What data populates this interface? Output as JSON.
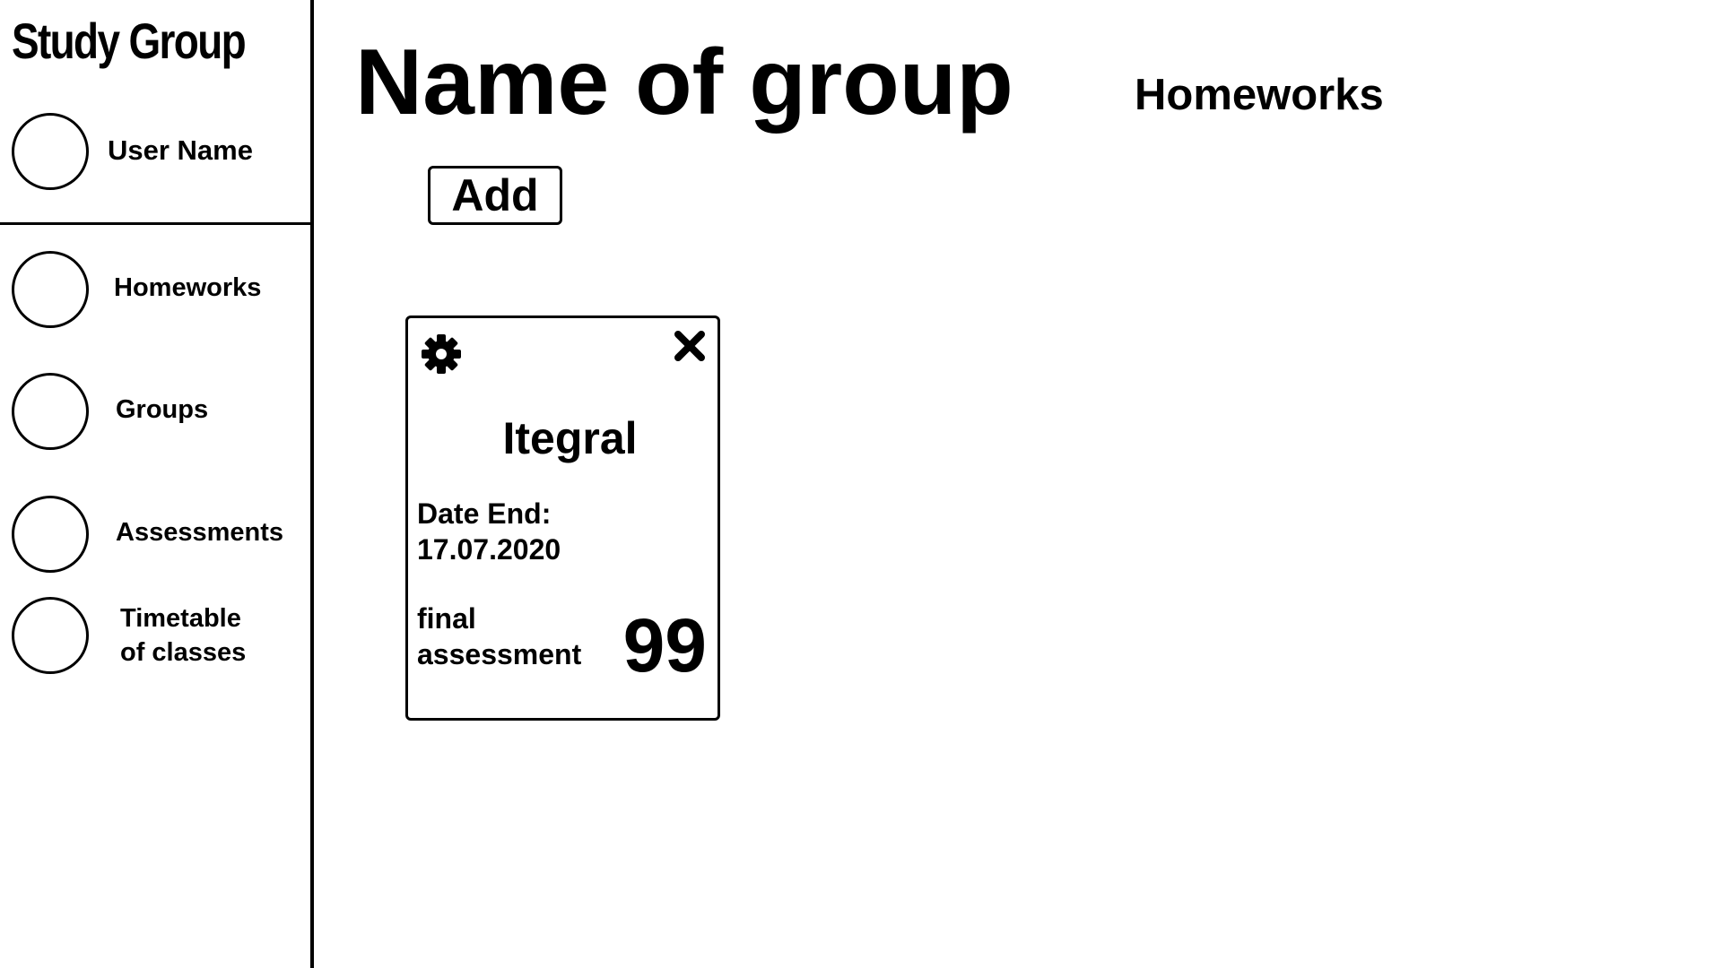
{
  "app": {
    "title": "Study Group"
  },
  "user": {
    "name": "User Name"
  },
  "sidebar": {
    "items": [
      {
        "label": "Homeworks",
        "icon": "circle-icon"
      },
      {
        "label": "Groups",
        "icon": "circle-icon"
      },
      {
        "label": "Assessments",
        "icon": "circle-icon"
      },
      {
        "label": "Timetable\nof classes",
        "icon": "circle-icon"
      }
    ]
  },
  "main": {
    "page_title": "Name of group",
    "section_title": "Homeworks",
    "add_label": "Add"
  },
  "cards": [
    {
      "title": "Itegral",
      "date_label": "Date End:",
      "date_value": "17.07.2020",
      "final_label_line1": "final",
      "final_label_line2": "assessment",
      "score": "99",
      "settings_icon": "gear-icon",
      "close_icon": "close-icon"
    }
  ]
}
